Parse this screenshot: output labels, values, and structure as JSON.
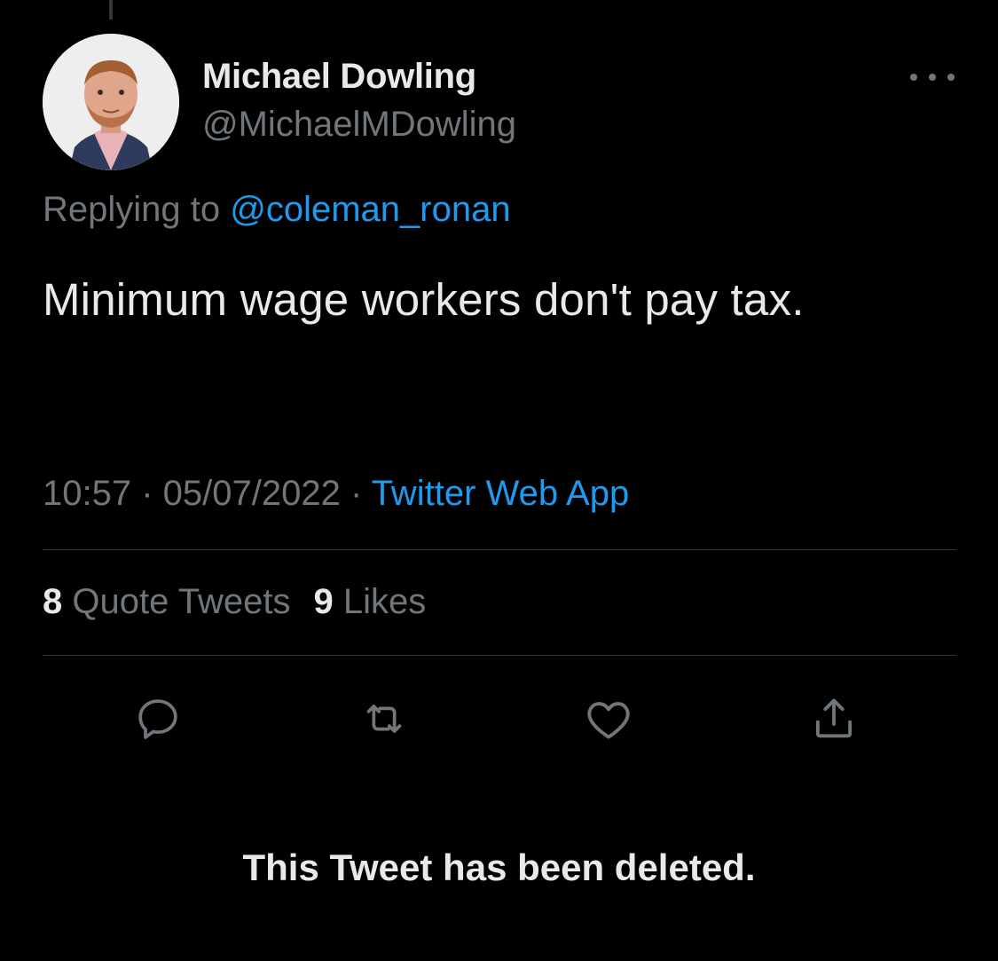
{
  "author": {
    "display_name": "Michael Dowling",
    "handle": "@MichaelMDowling"
  },
  "reply": {
    "prefix": "Replying to ",
    "to_handle": "@coleman_ronan"
  },
  "tweet": {
    "text": "Minimum wage workers don't pay tax."
  },
  "meta": {
    "time": "10:57",
    "separator": " · ",
    "date": "05/07/2022",
    "source": "Twitter Web App"
  },
  "stats": {
    "quote_count": "8",
    "quote_label": "Quote Tweets",
    "like_count": "9",
    "like_label": "Likes"
  },
  "actions": {
    "reply_icon": "reply-icon",
    "retweet_icon": "retweet-icon",
    "like_icon": "heart-icon",
    "share_icon": "share-icon"
  },
  "deleted_notice": "This Tweet has been deleted.",
  "colors": {
    "background": "#000000",
    "primary_text": "#e7e9ea",
    "secondary_text": "#71767b",
    "link": "#1d9bf0",
    "divider": "#2f3336"
  }
}
